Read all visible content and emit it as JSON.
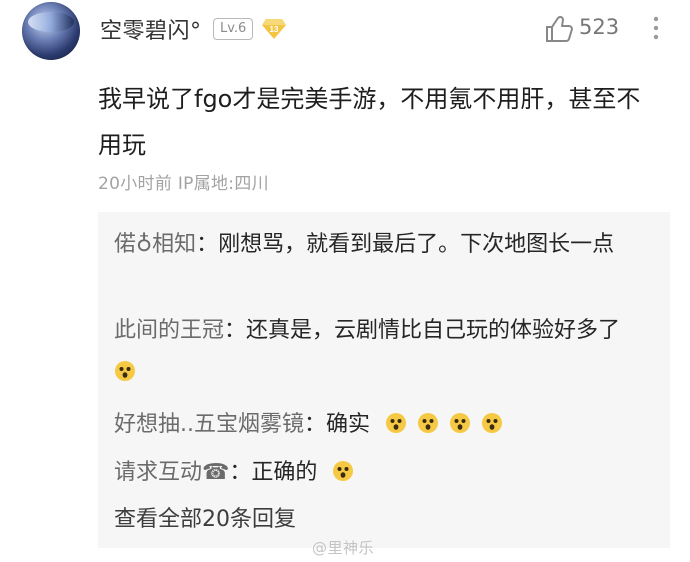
{
  "comment": {
    "username": "空零碧闪°",
    "level": "Lv.6",
    "vip_level": "13",
    "like_count": "523",
    "text": "我早说了fgo才是完美手游，不用氪不用肝，甚至不用玩",
    "meta": "20小时前  IP属地:四川"
  },
  "replies": [
    {
      "author": "偌♁相知",
      "text": "：刚想骂，就看到最后了。下次地图长一点",
      "emoji_count": 0
    },
    {
      "author": "此间的王冠",
      "text": "：还真是，云剧情比自己玩的体验好多了",
      "emoji_count": 1
    },
    {
      "author": "好想抽..五宝烟雾镜",
      "text": "：确实",
      "emoji_count": 4
    },
    {
      "author": "请求互动☎",
      "text": "：正确的",
      "emoji_count": 1
    }
  ],
  "view_all": "查看全部20条回复",
  "watermark": "@里神乐",
  "icons": {
    "like": "thumbs-up-icon",
    "more": "more-vertical-icon",
    "vip": "diamond-vip-icon",
    "emoji": "shocked-face-emoji"
  },
  "colors": {
    "username": "#333333",
    "reply_bg": "#f6f6f6",
    "meta": "#a3a3a3",
    "vip": "#f4c542"
  }
}
